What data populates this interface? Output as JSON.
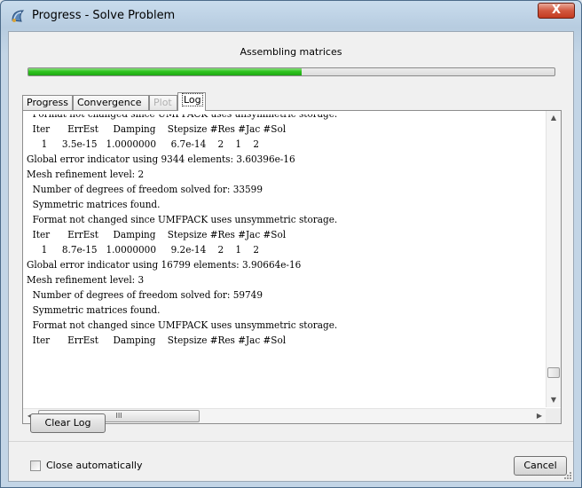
{
  "window": {
    "title": "Progress - Solve Problem",
    "close_glyph": "X",
    "icon": "app-icon"
  },
  "progress": {
    "status": "Assembling matrices",
    "fraction": 0.52,
    "accent_color": "#2ec41e"
  },
  "tabs": [
    {
      "label": "Progress",
      "state": "normal"
    },
    {
      "label": "Convergence",
      "state": "normal"
    },
    {
      "label": "Plot",
      "state": "disabled"
    },
    {
      "label": "Log",
      "state": "active"
    }
  ],
  "log": {
    "lines": [
      "  Format not changed since UMFPACK uses unsymmetric storage.",
      "  Iter      ErrEst     Damping    Stepsize #Res #Jac #Sol",
      "     1     3.5e-15   1.0000000     6.7e-14    2    1    2",
      "Global error indicator using 9344 elements: 3.60396e-16",
      "Mesh refinement level: 2",
      "  Number of degrees of freedom solved for: 33599",
      "  Symmetric matrices found.",
      "  Format not changed since UMFPACK uses unsymmetric storage.",
      "  Iter      ErrEst     Damping    Stepsize #Res #Jac #Sol",
      "     1     8.7e-15   1.0000000     9.2e-14    2    1    2",
      "Global error indicator using 16799 elements: 3.90664e-16",
      "Mesh refinement level: 3",
      "  Number of degrees of freedom solved for: 59749",
      "  Symmetric matrices found.",
      "  Format not changed since UMFPACK uses unsymmetric storage.",
      "  Iter      ErrEst     Damping    Stepsize #Res #Jac #Sol"
    ],
    "scroll_up_glyph": "▲",
    "scroll_down_glyph": "▼",
    "scroll_left_glyph": "◀",
    "scroll_right_glyph": "▶",
    "hthumb_grip": "III"
  },
  "buttons": {
    "clear_log": "Clear Log",
    "cancel": "Cancel"
  },
  "options": {
    "close_automatically_label": "Close automatically",
    "close_automatically_checked": false
  }
}
